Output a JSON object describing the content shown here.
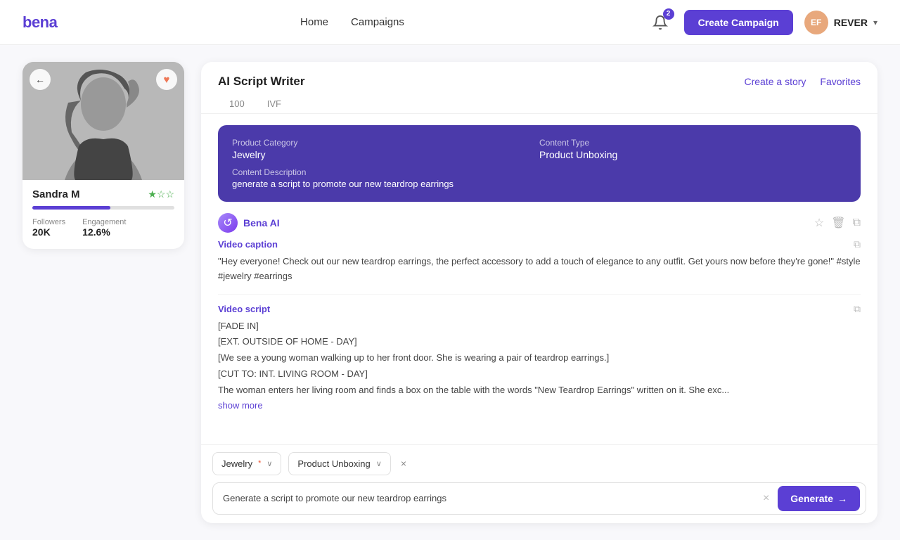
{
  "app": {
    "logo_text": "bena",
    "nav": {
      "home": "Home",
      "campaigns": "Campaigns"
    },
    "notifications_count": "2",
    "create_campaign_label": "Create Campaign",
    "user": {
      "name": "REVER",
      "initials": "EF"
    }
  },
  "profile": {
    "name": "Sandra M",
    "followers_label": "Followers",
    "followers_value": "20K",
    "engagement_label": "Engagement",
    "engagement_value": "12.6%",
    "back_icon": "←",
    "fav_icon": "♥"
  },
  "script_writer": {
    "title": "AI Script Writer",
    "create_story_label": "Create a story",
    "favorites_label": "Favorites",
    "tabs": [
      {
        "label": "100",
        "active": false
      },
      {
        "label": "IVF",
        "active": false
      }
    ]
  },
  "summary_card": {
    "product_category_label": "Product Category",
    "product_category_value": "Jewelry",
    "content_type_label": "Content Type",
    "content_type_value": "Product Unboxing",
    "content_description_label": "Content Description",
    "content_description_value": "generate a script to promote our new teardrop earrings"
  },
  "ai_message": {
    "sender": "Bena AI",
    "avatar_icon": "↺",
    "star_icon": "☆",
    "delete_icon": "🗑",
    "copy_all_icon": "⧉",
    "video_caption": {
      "title": "Video caption",
      "text": "\"Hey everyone! Check out our new teardrop earrings, the perfect accessory to add a touch of elegance to any outfit. Get yours now before they're gone!\" #style #jewelry #earrings",
      "copy_icon": "⧉"
    },
    "video_script": {
      "title": "Video script",
      "lines": [
        "[FADE IN]",
        "[EXT. OUTSIDE OF HOME - DAY]",
        "[We see a young woman walking up to her front door. She is wearing a pair of teardrop earrings.]",
        "[CUT TO: INT. LIVING ROOM - DAY]",
        "The woman enters her living room and finds a box on the table with the words \"New Teardrop Earrings\" written on it. She exc..."
      ],
      "show_more_label": "show more",
      "copy_icon": "⧉"
    }
  },
  "input_area": {
    "filter1": {
      "label": "Jewelry",
      "required_marker": "*",
      "chevron": "∨"
    },
    "filter2": {
      "label": "Product Unboxing",
      "chevron": "∨",
      "close_icon": "×"
    },
    "message_placeholder": "Generate a script to promote our new teardrop earrings",
    "message_value": "Generate a script to promote our new teardrop earrings",
    "clear_icon": "×",
    "generate_label": "Generate",
    "generate_arrow": "→"
  }
}
